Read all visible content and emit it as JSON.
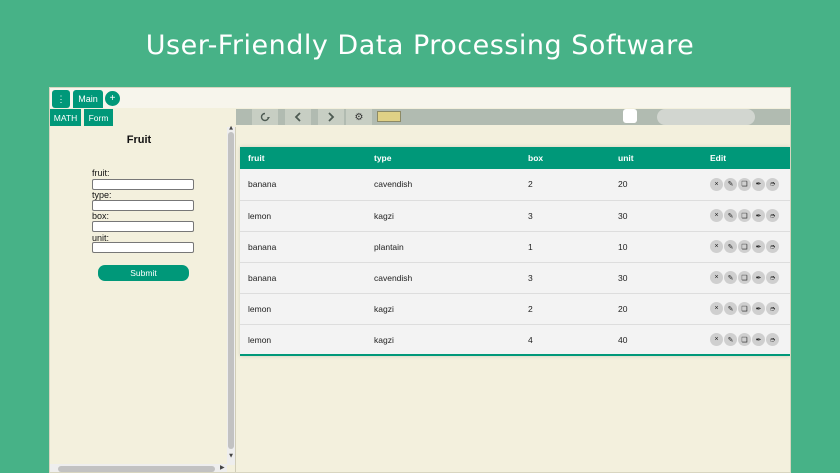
{
  "page": {
    "headline": "User-Friendly Data Processing Software"
  },
  "topbar": {
    "menu_icon": "⋮",
    "main_tab_label": "Main",
    "add_label": "+"
  },
  "subtabs": [
    {
      "label": "MATH"
    },
    {
      "label": "Form"
    }
  ],
  "toolbar": {
    "icons": [
      "refresh-icon",
      "chevron-left-icon",
      "chevron-right-icon",
      "gear-icon"
    ],
    "swatch_color": "#e0d186"
  },
  "form": {
    "title": "Fruit",
    "fields": [
      {
        "label": "fruit:",
        "value": ""
      },
      {
        "label": "type:",
        "value": ""
      },
      {
        "label": "box:",
        "value": ""
      },
      {
        "label": "unit:",
        "value": ""
      }
    ],
    "submit_label": "Submit"
  },
  "table": {
    "headers": [
      "fruit",
      "type",
      "box",
      "unit",
      "Edit"
    ],
    "rows": [
      [
        "banana",
        "cavendish",
        "2",
        "20"
      ],
      [
        "lemon",
        "kagzi",
        "3",
        "30"
      ],
      [
        "banana",
        "plantain",
        "1",
        "10"
      ],
      [
        "banana",
        "cavendish",
        "3",
        "30"
      ],
      [
        "lemon",
        "kagzi",
        "2",
        "20"
      ],
      [
        "lemon",
        "kagzi",
        "4",
        "40"
      ]
    ],
    "action_icons": [
      "×",
      "✎",
      "❏",
      "✒",
      "➮"
    ]
  },
  "colors": {
    "accent": "#009879",
    "background": "#47b287",
    "panel": "#f3f0dd"
  }
}
